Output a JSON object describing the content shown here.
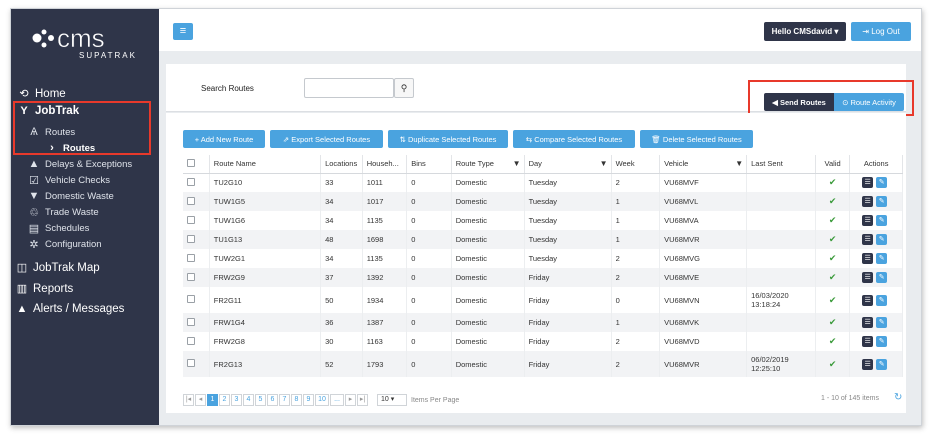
{
  "brand": {
    "name": "cms",
    "sub": "SUPATRAK"
  },
  "topbar": {
    "menu_icon": "hamburger-icon",
    "hello": "Hello CMSdavid ▾",
    "logout": "⇥ Log Out"
  },
  "sidebar": {
    "home": "Home",
    "jobtrak": "JobTrak",
    "routes_header": "Routes",
    "routes_active": "Routes",
    "items": [
      "Delays & Exceptions",
      "Vehicle Checks",
      "Domestic Waste",
      "Trade Waste",
      "Schedules",
      "Configuration"
    ],
    "jobtrak_map": "JobTrak Map",
    "reports": "Reports",
    "alerts": "Alerts / Messages"
  },
  "search": {
    "label": "Search Routes",
    "value": "",
    "placeholder": ""
  },
  "actions": {
    "send_routes": "◀ Send Routes",
    "route_activity": "⊙ Route Activity"
  },
  "toolbar": {
    "add": "+ Add New Route",
    "export": "⇗ Export Selected Routes",
    "duplicate": "⇅ Duplicate Selected Routes",
    "compare": "⇆ Compare Selected Routes",
    "delete": "🗑 Delete Selected Routes"
  },
  "table": {
    "headers": [
      "",
      "Route Name",
      "Locations",
      "Househ...",
      "Bins",
      "Route Type",
      "Day",
      "Week",
      "Vehicle",
      "Last Sent",
      "Valid",
      "Actions"
    ],
    "rows": [
      {
        "name": "TU2G10",
        "loc": "33",
        "house": "1011",
        "bins": "0",
        "type": "Domestic",
        "day": "Tuesday",
        "week": "2",
        "vehicle": "VU68MVF",
        "sent": "",
        "valid": "✔"
      },
      {
        "name": "TUW1G5",
        "loc": "34",
        "house": "1017",
        "bins": "0",
        "type": "Domestic",
        "day": "Tuesday",
        "week": "1",
        "vehicle": "VU68MVL",
        "sent": "",
        "valid": "✔"
      },
      {
        "name": "TUW1G6",
        "loc": "34",
        "house": "1135",
        "bins": "0",
        "type": "Domestic",
        "day": "Tuesday",
        "week": "1",
        "vehicle": "VU68MVA",
        "sent": "",
        "valid": "✔"
      },
      {
        "name": "TU1G13",
        "loc": "48",
        "house": "1698",
        "bins": "0",
        "type": "Domestic",
        "day": "Tuesday",
        "week": "1",
        "vehicle": "VU68MVR",
        "sent": "",
        "valid": "✔"
      },
      {
        "name": "TUW2G1",
        "loc": "34",
        "house": "1135",
        "bins": "0",
        "type": "Domestic",
        "day": "Tuesday",
        "week": "2",
        "vehicle": "VU68MVG",
        "sent": "",
        "valid": "✔"
      },
      {
        "name": "FRW2G9",
        "loc": "37",
        "house": "1392",
        "bins": "0",
        "type": "Domestic",
        "day": "Friday",
        "week": "2",
        "vehicle": "VU68MVE",
        "sent": "",
        "valid": "✔"
      },
      {
        "name": "FR2G11",
        "loc": "50",
        "house": "1934",
        "bins": "0",
        "type": "Domestic",
        "day": "Friday",
        "week": "0",
        "vehicle": "VU68MVN",
        "sent": "16/03/2020 13:18:24",
        "valid": "✔"
      },
      {
        "name": "FRW1G4",
        "loc": "36",
        "house": "1387",
        "bins": "0",
        "type": "Domestic",
        "day": "Friday",
        "week": "1",
        "vehicle": "VU68MVK",
        "sent": "",
        "valid": "✔"
      },
      {
        "name": "FRW2G8",
        "loc": "30",
        "house": "1163",
        "bins": "0",
        "type": "Domestic",
        "day": "Friday",
        "week": "2",
        "vehicle": "VU68MVD",
        "sent": "",
        "valid": "✔"
      },
      {
        "name": "FR2G13",
        "loc": "52",
        "house": "1793",
        "bins": "0",
        "type": "Domestic",
        "day": "Friday",
        "week": "2",
        "vehicle": "VU68MVR",
        "sent": "06/02/2019 12:25:10",
        "valid": "✔"
      }
    ]
  },
  "pager": {
    "first": "|◂",
    "prev": "◂",
    "pages": [
      "1",
      "2",
      "3",
      "4",
      "5",
      "6",
      "7",
      "8",
      "9",
      "10",
      "..."
    ],
    "next": "▸",
    "last": "▸|",
    "per_page": "10",
    "per_page_label": "Items Per Page",
    "info": "1 - 10 of 145 items",
    "refresh_icon": "↻"
  },
  "colors": {
    "sidebar": "#2f3549",
    "accent": "#4aa3df",
    "highlight": "#e8392b"
  }
}
